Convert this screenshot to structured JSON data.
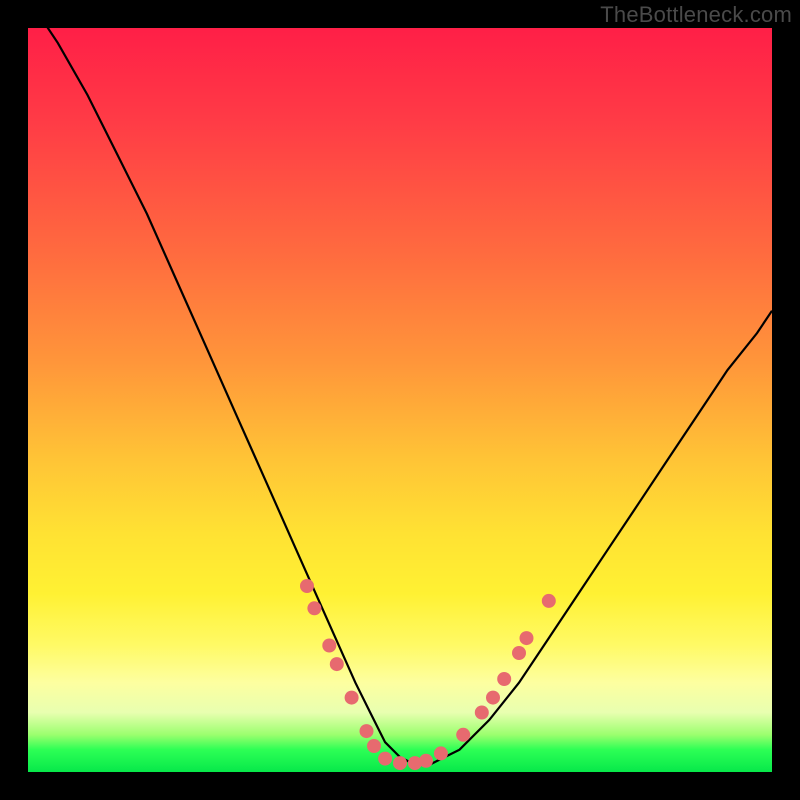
{
  "watermark": "TheBottleneck.com",
  "colors": {
    "frame": "#000000",
    "curve": "#000000",
    "dots": "#e76a6f",
    "gradient_top": "#ff1f47",
    "gradient_mid": "#ffe233",
    "gradient_bottom": "#07e84a"
  },
  "chart_data": {
    "type": "line",
    "title": "",
    "xlabel": "",
    "ylabel": "",
    "xlim": [
      0,
      100
    ],
    "ylim": [
      0,
      100
    ],
    "series": [
      {
        "name": "bottleneck-curve",
        "x": [
          0,
          4,
          8,
          12,
          16,
          20,
          24,
          28,
          32,
          36,
          40,
          44,
          46,
          48,
          50,
          52,
          54,
          56,
          58,
          62,
          66,
          70,
          74,
          78,
          82,
          86,
          90,
          94,
          98,
          100
        ],
        "values": [
          104,
          98,
          91,
          83,
          75,
          66,
          57,
          48,
          39,
          30,
          21,
          12,
          8,
          4,
          2,
          1,
          1,
          2,
          3,
          7,
          12,
          18,
          24,
          30,
          36,
          42,
          48,
          54,
          59,
          62
        ]
      }
    ],
    "annotations": {
      "dots": [
        {
          "x": 37.5,
          "y": 25
        },
        {
          "x": 38.5,
          "y": 22
        },
        {
          "x": 40.5,
          "y": 17
        },
        {
          "x": 41.5,
          "y": 14.5
        },
        {
          "x": 43.5,
          "y": 10
        },
        {
          "x": 45.5,
          "y": 5.5
        },
        {
          "x": 46.5,
          "y": 3.5
        },
        {
          "x": 48,
          "y": 1.8
        },
        {
          "x": 50,
          "y": 1.2
        },
        {
          "x": 52,
          "y": 1.2
        },
        {
          "x": 53.5,
          "y": 1.5
        },
        {
          "x": 55.5,
          "y": 2.5
        },
        {
          "x": 58.5,
          "y": 5
        },
        {
          "x": 61,
          "y": 8
        },
        {
          "x": 62.5,
          "y": 10
        },
        {
          "x": 64,
          "y": 12.5
        },
        {
          "x": 66,
          "y": 16
        },
        {
          "x": 67,
          "y": 18
        },
        {
          "x": 70,
          "y": 23
        }
      ]
    }
  }
}
